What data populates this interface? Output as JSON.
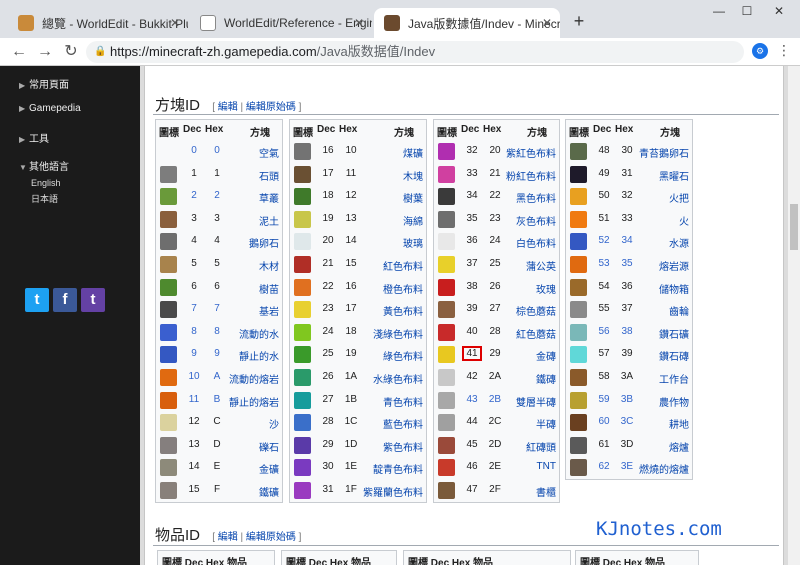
{
  "browser": {
    "tabs": [
      {
        "title": "總覽 - WorldEdit - Bukkit Plugin",
        "color": "#c98a3a"
      },
      {
        "title": "WorldEdit/Reference - EngineHu",
        "color": "#6d7178"
      },
      {
        "title": "Java版數據值/Indev - Minecraft",
        "color": "#6b4a2e"
      }
    ],
    "new_tab": "+",
    "min": "—",
    "max": "☐",
    "close": "✕",
    "url_domain": "https://minecraft-zh.gamepedia.com",
    "url_path": "/Java版数据值/Indev"
  },
  "sidebar": {
    "items": [
      "常用頁面",
      "Gamepedia",
      "工具",
      "其他語言"
    ],
    "languages": [
      "English",
      "日本語"
    ],
    "social": {
      "twitter": "t",
      "facebook": "f",
      "twitch": "t"
    }
  },
  "section_blocks": {
    "title": "方塊ID",
    "edit": "編輯",
    "edit_source": "編輯原始碼"
  },
  "section_items": {
    "title": "物品ID",
    "edit": "編輯",
    "edit_source": "編輯原始碼"
  },
  "columns": {
    "icon": "圖標",
    "dec": "Dec",
    "hex": "Hex",
    "name": "方塊",
    "item_name": "物品"
  },
  "blocks": [
    [
      {
        "dec": "0",
        "hex": "0",
        "name": "空氣",
        "c": ""
      },
      {
        "dec": "1",
        "hex": "1",
        "name": "石頭",
        "c": "#7d7d7d"
      },
      {
        "dec": "2",
        "hex": "2",
        "name": "草叢",
        "c": "#6a9a3a"
      },
      {
        "dec": "3",
        "hex": "3",
        "name": "泥土",
        "c": "#8a5f3c"
      },
      {
        "dec": "4",
        "hex": "4",
        "name": "鵝卵石",
        "c": "#6e6e6e"
      },
      {
        "dec": "5",
        "hex": "5",
        "name": "木材",
        "c": "#a8834c"
      },
      {
        "dec": "6",
        "hex": "6",
        "name": "樹苗",
        "c": "#4e8a2e"
      },
      {
        "dec": "7",
        "hex": "7",
        "name": "基岩",
        "c": "#4a4a4a"
      },
      {
        "dec": "8",
        "hex": "8",
        "name": "流動的水",
        "c": "#3a5fcf"
      },
      {
        "dec": "9",
        "hex": "9",
        "name": "靜止的水",
        "c": "#3458c2"
      },
      {
        "dec": "10",
        "hex": "A",
        "name": "流動的熔岩",
        "c": "#e06a10"
      },
      {
        "dec": "11",
        "hex": "B",
        "name": "靜止的熔岩",
        "c": "#d85e0c"
      },
      {
        "dec": "12",
        "hex": "C",
        "name": "沙",
        "c": "#dbd29e"
      },
      {
        "dec": "13",
        "hex": "D",
        "name": "礫石",
        "c": "#857f7e"
      },
      {
        "dec": "14",
        "hex": "E",
        "name": "金礦",
        "c": "#8d8a7a"
      },
      {
        "dec": "15",
        "hex": "F",
        "name": "鐵礦",
        "c": "#88807a"
      }
    ],
    [
      {
        "dec": "16",
        "hex": "10",
        "name": "煤礦",
        "c": "#737373"
      },
      {
        "dec": "17",
        "hex": "11",
        "name": "木塊",
        "c": "#6a5033"
      },
      {
        "dec": "18",
        "hex": "12",
        "name": "樹葉",
        "c": "#3f7a2a"
      },
      {
        "dec": "19",
        "hex": "13",
        "name": "海綿",
        "c": "#c8c64a"
      },
      {
        "dec": "20",
        "hex": "14",
        "name": "玻璃",
        "c": "#dfe8ea"
      },
      {
        "dec": "21",
        "hex": "15",
        "name": "紅色布料",
        "c": "#b02e26"
      },
      {
        "dec": "22",
        "hex": "16",
        "name": "橙色布料",
        "c": "#e07020"
      },
      {
        "dec": "23",
        "hex": "17",
        "name": "黃色布料",
        "c": "#e8d030"
      },
      {
        "dec": "24",
        "hex": "18",
        "name": "淺綠色布料",
        "c": "#80c71f"
      },
      {
        "dec": "25",
        "hex": "19",
        "name": "綠色布料",
        "c": "#3a9a2a"
      },
      {
        "dec": "26",
        "hex": "1A",
        "name": "水綠色布料",
        "c": "#2a9a6a"
      },
      {
        "dec": "27",
        "hex": "1B",
        "name": "青色布料",
        "c": "#169c9c"
      },
      {
        "dec": "28",
        "hex": "1C",
        "name": "藍色布料",
        "c": "#3a6fc9"
      },
      {
        "dec": "29",
        "hex": "1D",
        "name": "紫色布料",
        "c": "#5a3aa8"
      },
      {
        "dec": "30",
        "hex": "1E",
        "name": "靛青色布料",
        "c": "#7a3ac0"
      },
      {
        "dec": "31",
        "hex": "1F",
        "name": "紫羅蘭色布料",
        "c": "#9a3ac0"
      }
    ],
    [
      {
        "dec": "32",
        "hex": "20",
        "name": "紫紅色布料",
        "c": "#b02eb0"
      },
      {
        "dec": "33",
        "hex": "21",
        "name": "粉紅色布料",
        "c": "#d040a0"
      },
      {
        "dec": "34",
        "hex": "22",
        "name": "黑色布料",
        "c": "#3a3a3a"
      },
      {
        "dec": "35",
        "hex": "23",
        "name": "灰色布料",
        "c": "#6e6e6e"
      },
      {
        "dec": "36",
        "hex": "24",
        "name": "白色布料",
        "c": "#e8e8e8"
      },
      {
        "dec": "37",
        "hex": "25",
        "name": "蒲公英",
        "c": "#e8d02a"
      },
      {
        "dec": "38",
        "hex": "26",
        "name": "玫瑰",
        "c": "#c81e1e"
      },
      {
        "dec": "39",
        "hex": "27",
        "name": "棕色蘑菇",
        "c": "#8a6040"
      },
      {
        "dec": "40",
        "hex": "28",
        "name": "紅色蘑菇",
        "c": "#c82a2a"
      },
      {
        "dec": "41",
        "hex": "29",
        "name": "金磚",
        "c": "#e8c820"
      },
      {
        "dec": "42",
        "hex": "2A",
        "name": "鐵磚",
        "c": "#c8c8c8"
      },
      {
        "dec": "43",
        "hex": "2B",
        "name": "雙層半磚",
        "c": "#a8a8a8"
      },
      {
        "dec": "44",
        "hex": "2C",
        "name": "半磚",
        "c": "#a0a0a0"
      },
      {
        "dec": "45",
        "hex": "2D",
        "name": "紅磚頭",
        "c": "#9a4a3a"
      },
      {
        "dec": "46",
        "hex": "2E",
        "name": "TNT",
        "c": "#c83a2a"
      },
      {
        "dec": "47",
        "hex": "2F",
        "name": "書櫃",
        "c": "#7a5a3a"
      }
    ],
    [
      {
        "dec": "48",
        "hex": "30",
        "name": "青苔鵝卵石",
        "c": "#5a6a4a"
      },
      {
        "dec": "49",
        "hex": "31",
        "name": "黑曜石",
        "c": "#1e1a2a"
      },
      {
        "dec": "50",
        "hex": "32",
        "name": "火把",
        "c": "#e8a020"
      },
      {
        "dec": "51",
        "hex": "33",
        "name": "火",
        "c": "#f07a10"
      },
      {
        "dec": "52",
        "hex": "34",
        "name": "水源",
        "c": "#3458c2"
      },
      {
        "dec": "53",
        "hex": "35",
        "name": "熔岩源",
        "c": "#e06a10"
      },
      {
        "dec": "54",
        "hex": "36",
        "name": "儲物箱",
        "c": "#9a6a2a"
      },
      {
        "dec": "55",
        "hex": "37",
        "name": "齒輪",
        "c": "#8a8a8a"
      },
      {
        "dec": "56",
        "hex": "38",
        "name": "鑽石礦",
        "c": "#7ab8b8"
      },
      {
        "dec": "57",
        "hex": "39",
        "name": "鑽石磚",
        "c": "#60d8d8"
      },
      {
        "dec": "58",
        "hex": "3A",
        "name": "工作台",
        "c": "#8a5a2a"
      },
      {
        "dec": "59",
        "hex": "3B",
        "name": "農作物",
        "c": "#b8a030"
      },
      {
        "dec": "60",
        "hex": "3C",
        "name": "耕地",
        "c": "#6a4020"
      },
      {
        "dec": "61",
        "hex": "3D",
        "name": "熔爐",
        "c": "#5a5a5a"
      },
      {
        "dec": "62",
        "hex": "3E",
        "name": "燃燒的熔爐",
        "c": "#6a5a4a"
      }
    ]
  ],
  "blue_dec_rows": [
    "0",
    "2",
    "7",
    "8",
    "9",
    "10",
    "11",
    "43",
    "52",
    "53",
    "56",
    "59",
    "60",
    "62"
  ],
  "highlight_dec": "41",
  "watermark": "KJnotes.com"
}
